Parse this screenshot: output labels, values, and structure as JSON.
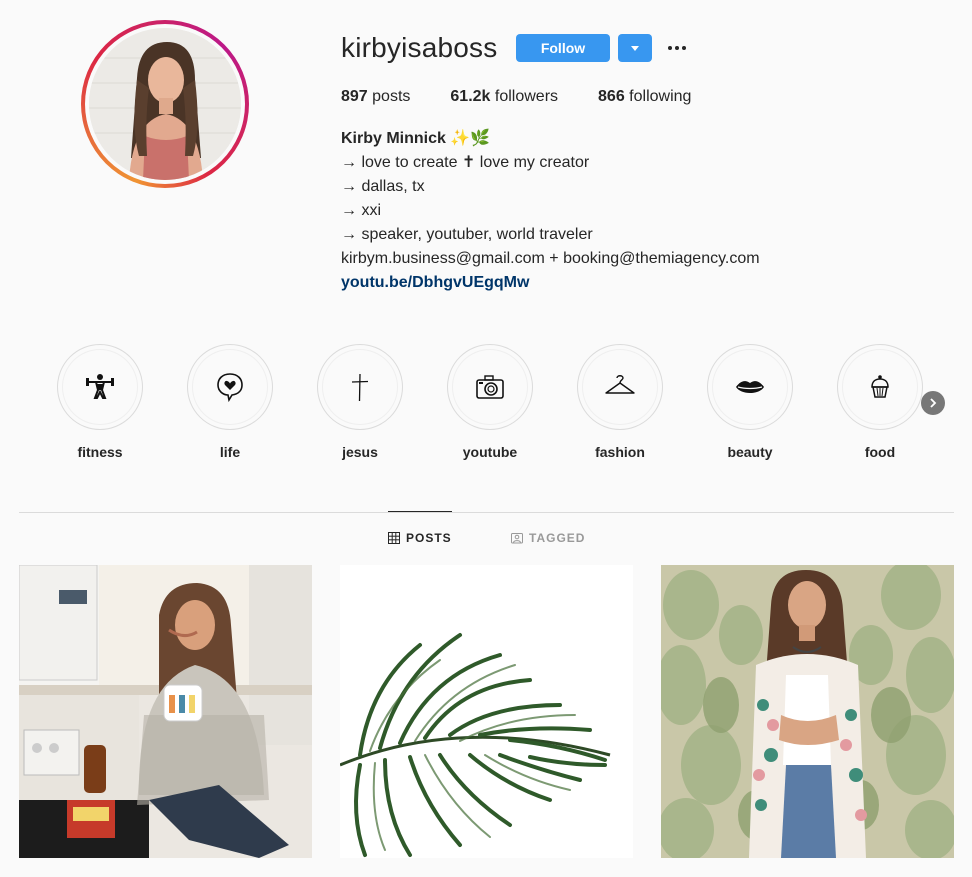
{
  "profile": {
    "username": "kirbyisaboss",
    "follow_label": "Follow",
    "more_label": "···",
    "stats": {
      "posts_count": "897",
      "posts_label": " posts",
      "followers_count": "61.2k",
      "followers_label": " followers",
      "following_count": "866",
      "following_label": " following"
    },
    "bio": {
      "name": "Kirby Minnick ✨🌿",
      "lines": [
        "→ love to create ✝ love my creator",
        "→ dallas, tx",
        "→ xxi",
        "→ speaker, youtuber, world traveler"
      ],
      "emails": "kirbym.business@gmail.com + booking@themiagency.com",
      "link": "youtu.be/DbhgvUEgqMw"
    }
  },
  "highlights": [
    {
      "label": "fitness",
      "icon": "weightlifter-icon"
    },
    {
      "label": "life",
      "icon": "heart-bubble-icon"
    },
    {
      "label": "jesus",
      "icon": "cross-icon"
    },
    {
      "label": "youtube",
      "icon": "camera-icon"
    },
    {
      "label": "fashion",
      "icon": "hanger-icon"
    },
    {
      "label": "beauty",
      "icon": "lips-icon"
    },
    {
      "label": "food",
      "icon": "cupcake-icon"
    }
  ],
  "tabs": {
    "posts_label": "POSTS",
    "tagged_label": "TAGGED"
  },
  "colors": {
    "accent": "#3897f0",
    "link": "#003569",
    "text": "#262626",
    "muted": "#999999",
    "background": "#fafafa"
  }
}
